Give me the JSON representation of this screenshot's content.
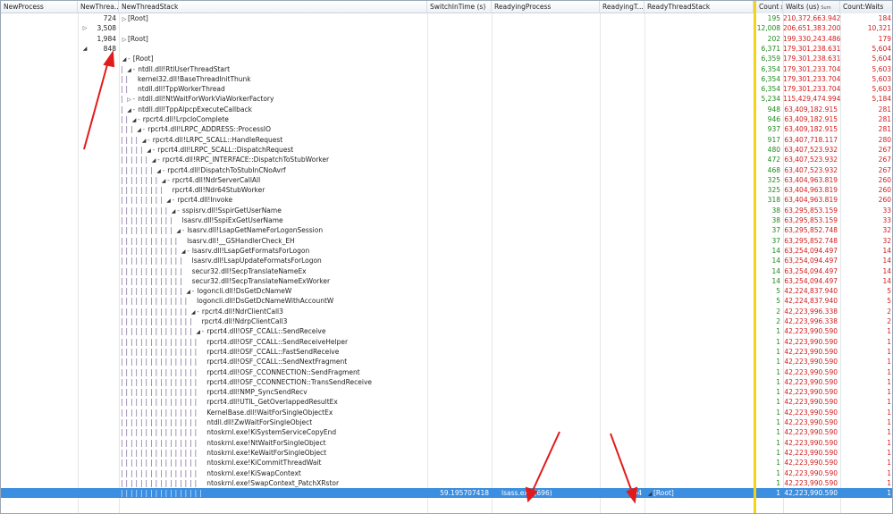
{
  "columns": {
    "new_process": "NewProcess",
    "new_thread": "NewThrea...",
    "new_thread_stack": "NewThreadStack",
    "switch_in_time": "SwitchInTime (s)",
    "readying_process": "ReadyingProcess",
    "readying_t": "ReadyingT...",
    "ready_thread_stack": "ReadyThreadStack",
    "count": "Count",
    "waits": "Waits (us)",
    "count_waits": "Count:Waits",
    "sort_marker": "Sum"
  },
  "top_rows": [
    {
      "tri": "",
      "nt": "724",
      "stack": "[Root]",
      "stack_tri": "▷",
      "count": "195",
      "waits": "210,372,663.942",
      "cw": "184"
    },
    {
      "tri": "▷",
      "nt": "3,508",
      "stack": "",
      "stack_tri": "",
      "count": "12,008",
      "waits": "206,651,383.200",
      "cw": "10,321"
    },
    {
      "tri": "",
      "nt": "1,984",
      "stack": "[Root]",
      "stack_tri": "▷",
      "count": "202",
      "waits": "199,330,243.486",
      "cw": "179"
    },
    {
      "tri": "◢",
      "nt": "848",
      "stack": "",
      "stack_tri": "",
      "count": "6,371",
      "waits": "179,301,238.631",
      "cw": "5,604"
    }
  ],
  "tree_rows": [
    {
      "depth": 0,
      "tri": "◢",
      "text": "[Root]",
      "count": "6,359",
      "waits": "179,301,238.631",
      "cw": "5,604"
    },
    {
      "depth": 1,
      "tri": "◢",
      "text": "ntdll.dll!RtlUserThreadStart",
      "count": "6,354",
      "waits": "179,301,233.704",
      "cw": "5,603"
    },
    {
      "depth": 2,
      "tri": "",
      "text": "kernel32.dll!BaseThreadInitThunk",
      "count": "6,354",
      "waits": "179,301,233.704",
      "cw": "5,603"
    },
    {
      "depth": 2,
      "tri": "",
      "text": "ntdll.dll!TppWorkerThread",
      "count": "6,354",
      "waits": "179,301,233.704",
      "cw": "5,603"
    },
    {
      "depth": 1,
      "tri": "▷",
      "text": "ntdll.dll!NtWaitForWorkViaWorkerFactory",
      "count": "5,234",
      "waits": "115,429,474.994",
      "cw": "5,184"
    },
    {
      "depth": 1,
      "tri": "◢",
      "text": "ntdll.dll!TppAlpcpExecuteCallback",
      "count": "948",
      "waits": "63,409,182.915",
      "cw": "281"
    },
    {
      "depth": 2,
      "tri": "◢",
      "text": "rpcrt4.dll!LrpcIoComplete",
      "count": "946",
      "waits": "63,409,182.915",
      "cw": "281"
    },
    {
      "depth": 3,
      "tri": "◢",
      "text": "rpcrt4.dll!LRPC_ADDRESS::ProcessIO",
      "count": "937",
      "waits": "63,409,182.915",
      "cw": "281"
    },
    {
      "depth": 4,
      "tri": "◢",
      "text": "rpcrt4.dll!LRPC_SCALL::HandleRequest",
      "count": "917",
      "waits": "63,407,718.117",
      "cw": "280"
    },
    {
      "depth": 5,
      "tri": "◢",
      "text": "rpcrt4.dll!LRPC_SCALL::DispatchRequest",
      "count": "480",
      "waits": "63,407,523.932",
      "cw": "267"
    },
    {
      "depth": 6,
      "tri": "◢",
      "text": "rpcrt4.dll!RPC_INTERFACE::DispatchToStubWorker",
      "count": "472",
      "waits": "63,407,523.932",
      "cw": "267"
    },
    {
      "depth": 7,
      "tri": "◢",
      "text": "rpcrt4.dll!DispatchToStubInCNoAvrf",
      "count": "468",
      "waits": "63,407,523.932",
      "cw": "267"
    },
    {
      "depth": 8,
      "tri": "◢",
      "text": "rpcrt4.dll!NdrServerCallAll",
      "count": "325",
      "waits": "63,404,963.819",
      "cw": "260"
    },
    {
      "depth": 9,
      "tri": "",
      "text": "rpcrt4.dll!Ndr64StubWorker",
      "count": "325",
      "waits": "63,404,963.819",
      "cw": "260"
    },
    {
      "depth": 9,
      "tri": "◢",
      "text": "rpcrt4.dll!Invoke",
      "count": "318",
      "waits": "63,404,963.819",
      "cw": "260"
    },
    {
      "depth": 10,
      "tri": "◢",
      "text": "sspisrv.dll!SspirGetUserName",
      "count": "38",
      "waits": "63,295,853.159",
      "cw": "33"
    },
    {
      "depth": 11,
      "tri": "",
      "text": "lsasrv.dll!SspiExGetUserName",
      "count": "38",
      "waits": "63,295,853.159",
      "cw": "33"
    },
    {
      "depth": 11,
      "tri": "◢",
      "text": "lsasrv.dll!LsapGetNameForLogonSession",
      "count": "37",
      "waits": "63,295,852.748",
      "cw": "32"
    },
    {
      "depth": 12,
      "tri": "",
      "text": "lsasrv.dll!__GSHandlerCheck_EH",
      "count": "37",
      "waits": "63,295,852.748",
      "cw": "32"
    },
    {
      "depth": 12,
      "tri": "◢",
      "text": "lsasrv.dll!LsapGetFormatsForLogon",
      "count": "14",
      "waits": "63,254,094.497",
      "cw": "14"
    },
    {
      "depth": 13,
      "tri": "",
      "text": "lsasrv.dll!LsapUpdateFormatsForLogon",
      "count": "14",
      "waits": "63,254,094.497",
      "cw": "14"
    },
    {
      "depth": 13,
      "tri": "",
      "text": "secur32.dll!SecpTranslateNameEx",
      "count": "14",
      "waits": "63,254,094.497",
      "cw": "14"
    },
    {
      "depth": 13,
      "tri": "",
      "text": "secur32.dll!SecpTranslateNameExWorker",
      "count": "14",
      "waits": "63,254,094.497",
      "cw": "14"
    },
    {
      "depth": 13,
      "tri": "◢",
      "text": "logoncli.dll!DsGetDcNameW",
      "count": "5",
      "waits": "42,224,837.940",
      "cw": "5"
    },
    {
      "depth": 14,
      "tri": "",
      "text": "logoncli.dll!DsGetDcNameWithAccountW",
      "count": "5",
      "waits": "42,224,837.940",
      "cw": "5"
    },
    {
      "depth": 14,
      "tri": "◢",
      "text": "rpcrt4.dll!NdrClientCall3",
      "count": "2",
      "waits": "42,223,996.338",
      "cw": "2"
    },
    {
      "depth": 15,
      "tri": "",
      "text": "rpcrt4.dll!NdrpClientCall3",
      "count": "2",
      "waits": "42,223,996.338",
      "cw": "2"
    },
    {
      "depth": 15,
      "tri": "◢",
      "text": "rpcrt4.dll!OSF_CCALL::SendReceive",
      "count": "1",
      "waits": "42,223,990.590",
      "cw": "1"
    },
    {
      "depth": 16,
      "tri": "",
      "text": "rpcrt4.dll!OSF_CCALL::SendReceiveHelper",
      "count": "1",
      "waits": "42,223,990.590",
      "cw": "1"
    },
    {
      "depth": 16,
      "tri": "",
      "text": "rpcrt4.dll!OSF_CCALL::FastSendReceive",
      "count": "1",
      "waits": "42,223,990.590",
      "cw": "1"
    },
    {
      "depth": 16,
      "tri": "",
      "text": "rpcrt4.dll!OSF_CCALL::SendNextFragment",
      "count": "1",
      "waits": "42,223,990.590",
      "cw": "1"
    },
    {
      "depth": 16,
      "tri": "",
      "text": "rpcrt4.dll!OSF_CCONNECTION::SendFragment",
      "count": "1",
      "waits": "42,223,990.590",
      "cw": "1"
    },
    {
      "depth": 16,
      "tri": "",
      "text": "rpcrt4.dll!OSF_CCONNECTION::TransSendReceive",
      "count": "1",
      "waits": "42,223,990.590",
      "cw": "1"
    },
    {
      "depth": 16,
      "tri": "",
      "text": "rpcrt4.dll!NMP_SyncSendRecv",
      "count": "1",
      "waits": "42,223,990.590",
      "cw": "1"
    },
    {
      "depth": 16,
      "tri": "",
      "text": "rpcrt4.dll!UTIL_GetOverlappedResultEx",
      "count": "1",
      "waits": "42,223,990.590",
      "cw": "1"
    },
    {
      "depth": 16,
      "tri": "",
      "text": "KernelBase.dll!WaitForSingleObjectEx",
      "count": "1",
      "waits": "42,223,990.590",
      "cw": "1"
    },
    {
      "depth": 16,
      "tri": "",
      "text": "ntdll.dll!ZwWaitForSingleObject",
      "count": "1",
      "waits": "42,223,990.590",
      "cw": "1"
    },
    {
      "depth": 16,
      "tri": "",
      "text": "ntoskrnl.exe!KiSystemServiceCopyEnd",
      "count": "1",
      "waits": "42,223,990.590",
      "cw": "1"
    },
    {
      "depth": 16,
      "tri": "",
      "text": "ntoskrnl.exe!NtWaitForSingleObject",
      "count": "1",
      "waits": "42,223,990.590",
      "cw": "1"
    },
    {
      "depth": 16,
      "tri": "",
      "text": "ntoskrnl.exe!KeWaitForSingleObject",
      "count": "1",
      "waits": "42,223,990.590",
      "cw": "1"
    },
    {
      "depth": 16,
      "tri": "",
      "text": "ntoskrnl.exe!KiCommitThreadWait",
      "count": "1",
      "waits": "42,223,990.590",
      "cw": "1"
    },
    {
      "depth": 16,
      "tri": "",
      "text": "ntoskrnl.exe!KiSwapContext",
      "count": "1",
      "waits": "42,223,990.590",
      "cw": "1"
    },
    {
      "depth": 16,
      "tri": "",
      "text": "ntoskrnl.exe!SwapContext_PatchXRstor",
      "count": "1",
      "waits": "42,223,990.590",
      "cw": "1"
    }
  ],
  "selected_row": {
    "depth": 17,
    "switch_in_time": "59.195707418",
    "readying_process": "lsass.exe (696)",
    "readying_t": "804",
    "ready_stack_tri": "◢",
    "ready_stack": "[Root]",
    "count": "1",
    "waits": "42,223,990.590",
    "cw": "1"
  },
  "colors": {
    "green": "#1c8a1c",
    "red": "#d21b1b",
    "selection": "#3c8ee0",
    "annotation_arrow": "#e11b1b",
    "sort_divider": "#f2d21b"
  }
}
